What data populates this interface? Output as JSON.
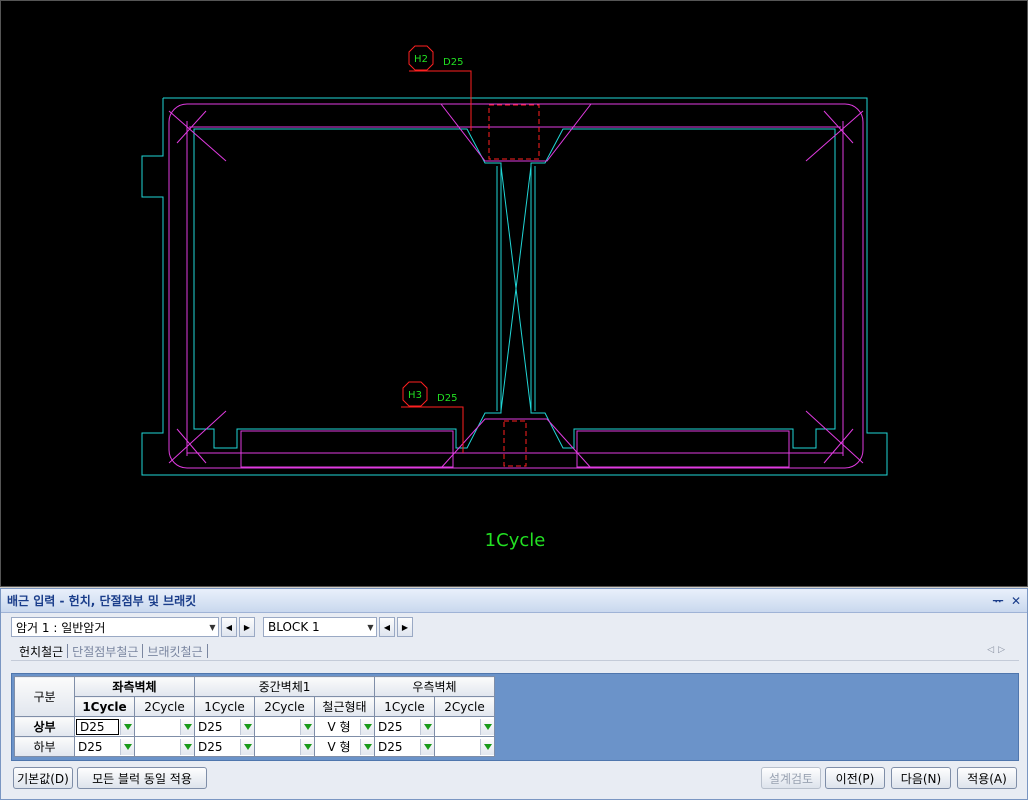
{
  "drawing": {
    "label": "1Cycle",
    "marker_top": "H2",
    "marker_top_rebar": "D25",
    "marker_bottom": "H3",
    "marker_bottom_rebar": "D25",
    "colors": {
      "concrete": "#21d6d6",
      "rebar": "#e03be0",
      "marker": "#ff2020",
      "label": "#22e022"
    }
  },
  "panel": {
    "title": "배근 입력 - 헌치, 단절점부 및 브래킷",
    "pin_icon": "pin-icon",
    "close_icon": "close-icon",
    "culvert_select": "암거 1 : 일반암거",
    "block_select": "BLOCK  1",
    "tabs": [
      "헌치철근",
      "단절점부철근",
      "브래킷철근"
    ],
    "active_tab": 0
  },
  "grid": {
    "corner_label": "구분",
    "groups": [
      "좌측벽체",
      "중간벽체1",
      "우측벽체"
    ],
    "columns": [
      "1Cycle",
      "2Cycle",
      "1Cycle",
      "2Cycle",
      "철근형태",
      "1Cycle",
      "2Cycle"
    ],
    "rows": [
      {
        "label": "상부",
        "cells": [
          "D25",
          "",
          "D25",
          "",
          "V 형",
          "D25",
          ""
        ]
      },
      {
        "label": "하부",
        "cells": [
          "D25",
          "",
          "D25",
          "",
          "V 형",
          "D25",
          ""
        ]
      }
    ]
  },
  "buttons": {
    "default": "기본값(D)",
    "apply_all": "모든 블럭 동일 적용",
    "design_check": "설계검토",
    "prev": "이전(P)",
    "next": "다음(N)",
    "apply": "적용(A)"
  }
}
